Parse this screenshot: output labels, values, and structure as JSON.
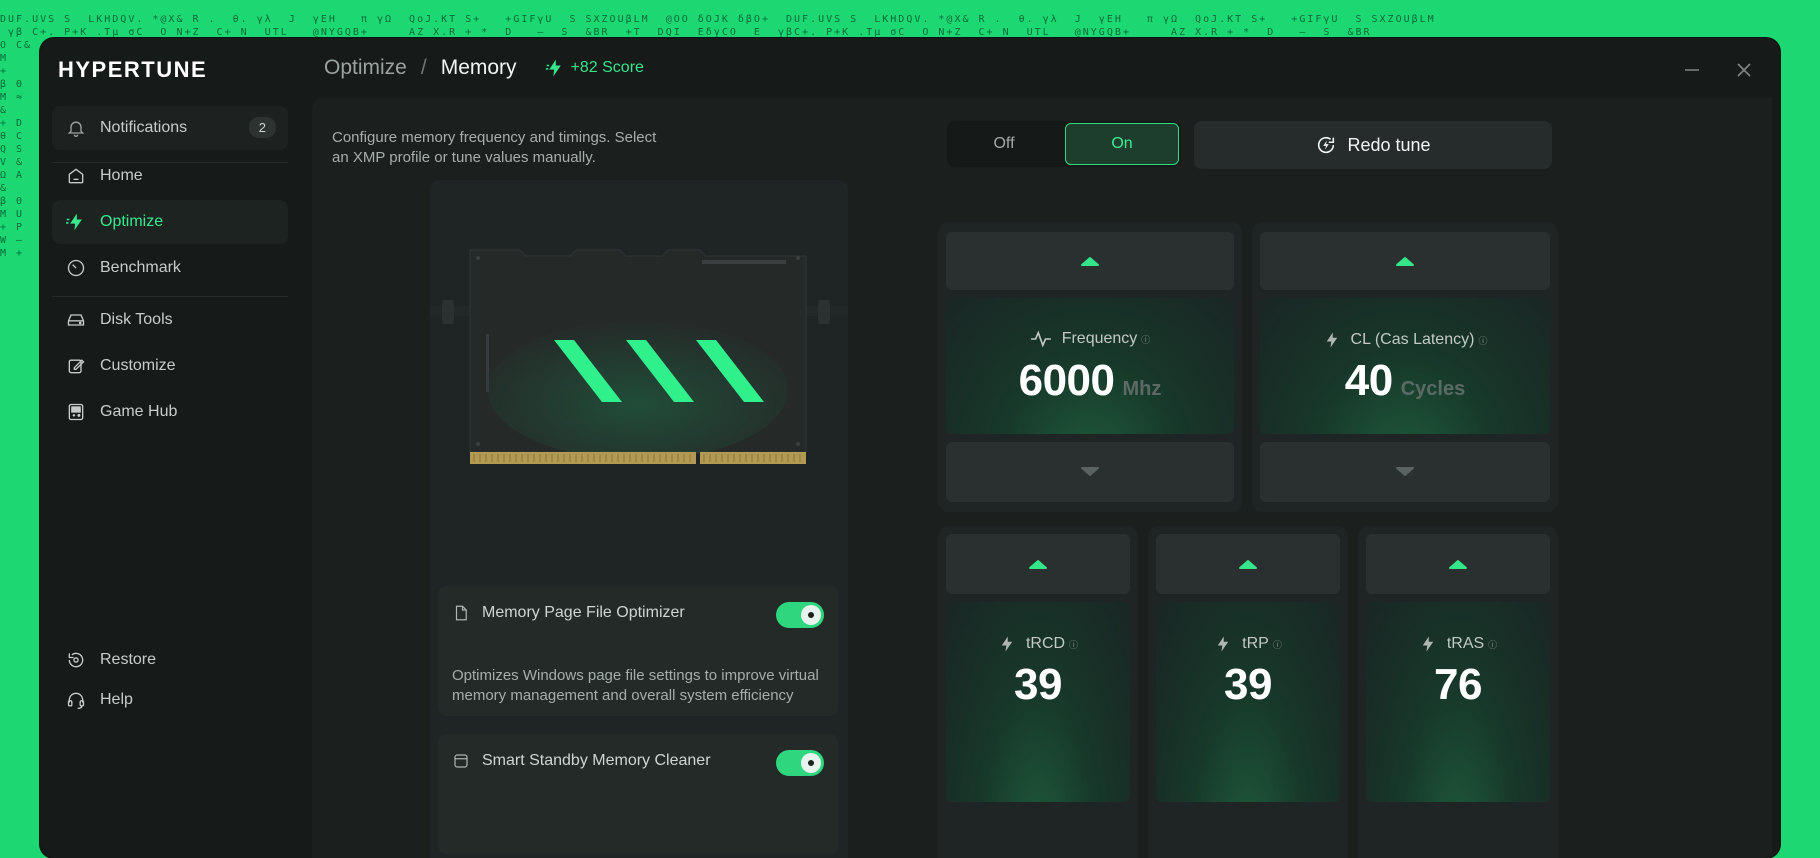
{
  "app": {
    "brand": "HYPERTUNE"
  },
  "breadcrumb": {
    "section": "Optimize",
    "separator": "/",
    "page": "Memory",
    "score": "+82 Score"
  },
  "sidebar": {
    "notifications": {
      "label": "Notifications",
      "count": "2"
    },
    "items": [
      {
        "label": "Home",
        "icon": "home-icon"
      },
      {
        "label": "Optimize",
        "icon": "bolt-icon",
        "active": true
      },
      {
        "label": "Benchmark",
        "icon": "gauge-icon"
      },
      {
        "label": "Disk Tools",
        "icon": "disk-icon"
      },
      {
        "label": "Customize",
        "icon": "edit-icon"
      },
      {
        "label": "Game Hub",
        "icon": "gamepad-icon"
      }
    ],
    "footer": [
      {
        "label": "Restore",
        "icon": "restore-icon"
      },
      {
        "label": "Help",
        "icon": "headset-icon"
      }
    ]
  },
  "main": {
    "description": "Configure memory frequency and timings. Select an XMP profile or tune values manually.",
    "toggle": {
      "off": "Off",
      "on": "On",
      "selected": "On"
    },
    "redo_label": "Redo tune",
    "options": [
      {
        "title": "Memory Page File Optimizer",
        "description": "Optimizes Windows page file settings to improve virtual memory management and overall system efficiency",
        "enabled": true
      },
      {
        "title": "Smart Standby Memory Cleaner",
        "enabled": true
      }
    ],
    "tiles": [
      {
        "label": "Frequency",
        "value": "6000",
        "unit": "Mhz",
        "icon": "pulse-icon"
      },
      {
        "label": "CL (Cas Latency)",
        "value": "40",
        "unit": "Cycles",
        "icon": "bolt-icon"
      },
      {
        "label": "tRCD",
        "value": "39",
        "unit": "",
        "icon": "bolt-icon"
      },
      {
        "label": "tRP",
        "value": "39",
        "unit": "",
        "icon": "bolt-icon"
      },
      {
        "label": "tRAS",
        "value": "76",
        "unit": "",
        "icon": "bolt-icon"
      }
    ]
  },
  "colors": {
    "accent": "#35e58a",
    "background": "#161a19",
    "panel": "#1b201f"
  }
}
